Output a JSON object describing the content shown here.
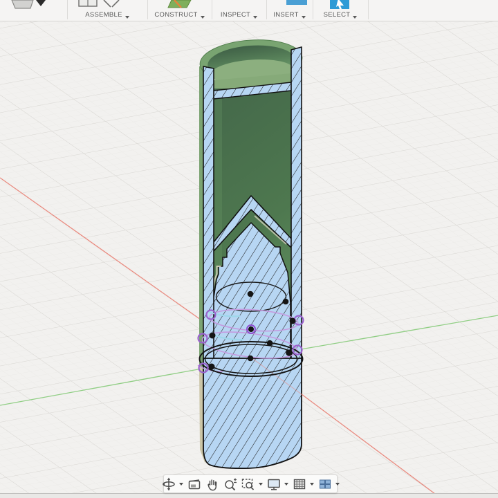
{
  "toolbar": {
    "groups": [
      {
        "label": "ASSEMBLE"
      },
      {
        "label": "CONSTRUCT"
      },
      {
        "label": "INSPECT"
      },
      {
        "label": "INSERT"
      },
      {
        "label": "SELECT"
      }
    ]
  },
  "navbar": {
    "items": [
      {
        "name": "orbit",
        "dropdown": true
      },
      {
        "name": "look-at",
        "dropdown": false
      },
      {
        "name": "pan",
        "dropdown": false
      },
      {
        "name": "zoom",
        "dropdown": false
      },
      {
        "name": "fit",
        "dropdown": true
      },
      {
        "name": "display-settings",
        "dropdown": true
      },
      {
        "name": "grid-and-snaps",
        "dropdown": true
      },
      {
        "name": "viewports",
        "dropdown": true
      }
    ]
  },
  "canvas": {
    "axes": {
      "x_axis_color": "#E98B80",
      "z_axis_color": "#90CE84"
    },
    "model": {
      "body_green": "#6F9C68",
      "section_hatch_fill": "#B7D6F3",
      "hatch_line": "#1F1F1F",
      "sketch_purple": "#9A63CE",
      "sketch_lavender": "#C49BE0",
      "sketch_cyan": "#9ED7EA",
      "outer_sliver_tan": "#CBC5A7"
    }
  }
}
